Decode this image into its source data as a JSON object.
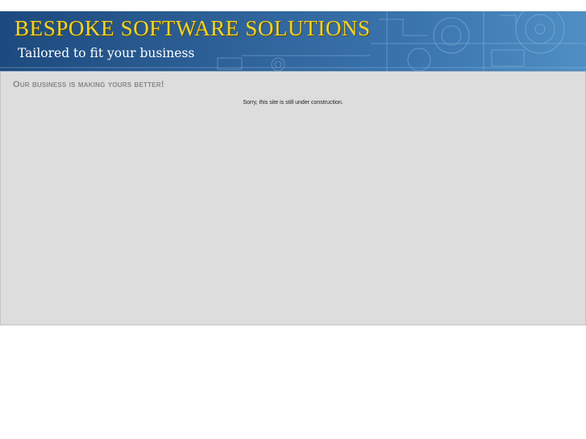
{
  "header": {
    "title": "BESPOKE SOFTWARE SOLUTIONS",
    "tagline": "Tailored to fit your business"
  },
  "main": {
    "slogan": "Our business is making yours better!",
    "notice": "Sorry, this site is still under construction."
  },
  "colors": {
    "title": "#f2d42a",
    "banner": "#2c5f96",
    "content_bg": "#dddddd"
  }
}
